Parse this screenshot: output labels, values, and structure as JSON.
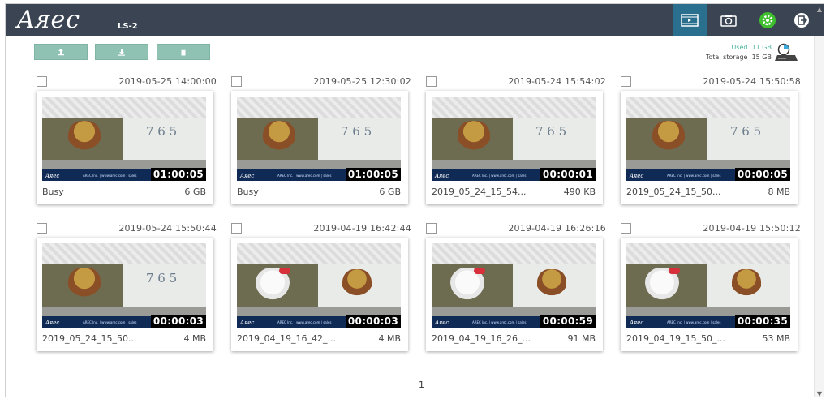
{
  "header": {
    "logo": "Aᴙec",
    "model": "LS-2",
    "nav": [
      {
        "name": "record-list-icon",
        "active": true
      },
      {
        "name": "camera-icon",
        "active": false
      },
      {
        "name": "settings-gear-icon",
        "active": false,
        "color": "#3fbf2f"
      },
      {
        "name": "logout-icon",
        "active": false
      }
    ]
  },
  "toolbar": {
    "buttons": [
      "upload-icon",
      "download-icon",
      "delete-icon"
    ],
    "accent": "#8fc2b3"
  },
  "storage": {
    "used_label": "Used",
    "used_value": "11 GB",
    "total_label": "Total storage",
    "total_value": "15 GB"
  },
  "recordings": [
    {
      "date": "2019-05-25  14:00:00",
      "duration": "01:00:05",
      "name": "Busy",
      "size": "6 GB",
      "scene": "doll"
    },
    {
      "date": "2019-05-25  12:30:02",
      "duration": "01:00:05",
      "name": "Busy",
      "size": "6 GB",
      "scene": "doll"
    },
    {
      "date": "2019-05-24  15:54:02",
      "duration": "00:00:01",
      "name": "2019_05_24_15_54...",
      "size": "490 KB",
      "scene": "doll"
    },
    {
      "date": "2019-05-24  15:50:58",
      "duration": "00:00:05",
      "name": "2019_05_24_15_50...",
      "size": "8 MB",
      "scene": "doll"
    },
    {
      "date": "2019-05-24  15:50:44",
      "duration": "00:00:03",
      "name": "2019_05_24_15_50...",
      "size": "4 MB",
      "scene": "doll"
    },
    {
      "date": "2019-04-19  16:42:44",
      "duration": "00:00:03",
      "name": "2019_04_19_16_42_...",
      "size": "4 MB",
      "scene": "kitty"
    },
    {
      "date": "2019-04-19  16:26:16",
      "duration": "00:00:59",
      "name": "2019_04_19_16_26_...",
      "size": "91 MB",
      "scene": "kitty"
    },
    {
      "date": "2019-04-19  15:50:12",
      "duration": "00:00:35",
      "name": "2019_04_19_15_50_...",
      "size": "53 MB",
      "scene": "kitty"
    }
  ],
  "overlay": {
    "bar_logo": "Aᴙec",
    "bar_text": "AREC Inc. | www.arec.com | sales"
  },
  "pagination": {
    "current": "1"
  }
}
